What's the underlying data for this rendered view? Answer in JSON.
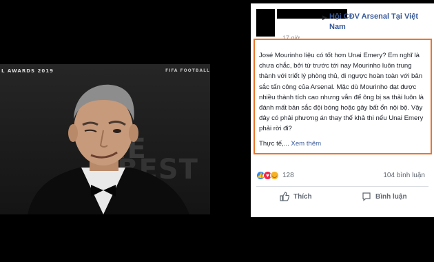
{
  "photo": {
    "bg_awards": "L AWARDS 2019",
    "bg_fifa": "FIFA FOOTBALL",
    "bg_big1": "HE",
    "bg_big2": "BEST"
  },
  "post": {
    "group_name": "Hội CĐV Arsenal Tại Việt Nam",
    "time": "17 giờ",
    "body": "José Mourinho liệu có tốt hơn Unai Emery? Em nghĩ là chưa chắc, bởi từ trước tới nay Mourinho luôn trung thành với triết lý phòng thủ, đi ngược hoàn toàn với bản sắc tấn công của Arsenal. Mặc dù Mourinho đạt được nhiều thành tích cao nhưng vẫn để ông bị sa thải luôn là đánh mất bản sắc đội bóng hoặc gây bất ổn nội bộ. Vậy đây có phải phương án thay thế khả thi nếu Unai Emery phải rời đi?",
    "truncated": "Thực tế,...",
    "see_more": "Xem thêm",
    "reaction_count": "128",
    "comment_count": "104 bình luận",
    "like_label": "Thích",
    "comment_label": "Bình luận"
  },
  "colors": {
    "highlight_border": "#e8762c",
    "link": "#365899"
  }
}
